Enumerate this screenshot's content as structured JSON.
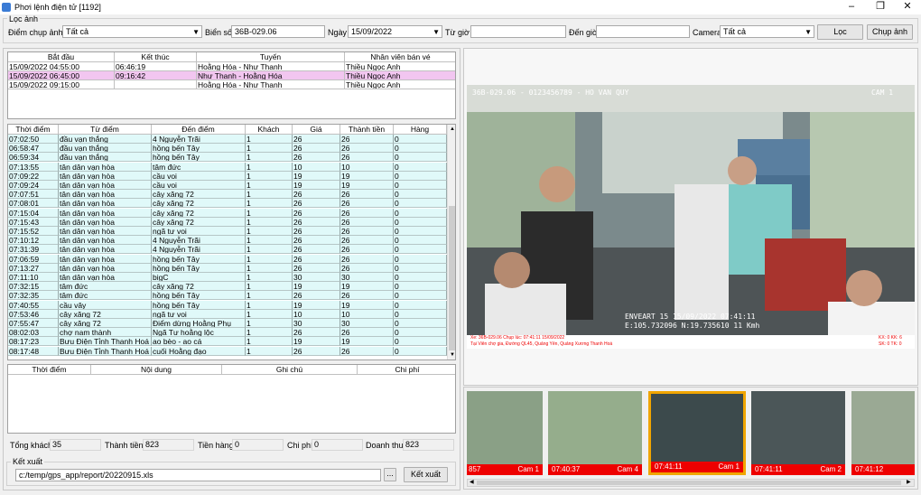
{
  "window": {
    "title": "Phơi lệnh điện tử [1192]"
  },
  "filter": {
    "group_label": "Lọc ảnh",
    "diem_label": "Điểm chụp ảnh",
    "diem_value": "Tất cả",
    "bienso_label": "Biển số",
    "bienso_value": "36B-029.06",
    "ngay_label": "Ngày",
    "ngay_value": "15/09/2022",
    "tugio_label": "Từ giờ",
    "tugio_value": "",
    "dengio_label": "Đến giờ",
    "dengio_value": "",
    "camera_label": "Camera",
    "camera_value": "Tất cả",
    "loc_btn": "Lọc",
    "chup_btn": "Chụp ảnh"
  },
  "trips": {
    "headers": [
      "Bắt đầu",
      "Kết thúc",
      "Tuyến",
      "Nhân viên bán vé"
    ],
    "rows": [
      [
        "15/09/2022 04:55:00",
        "06:46:19",
        "Hoằng Hóa - Như Thanh",
        "Thiều Ngọc Anh"
      ],
      [
        "15/09/2022 06:45:00",
        "09:16:42",
        "Như Thanh - Hoằng Hóa",
        "Thiều Ngọc Anh"
      ],
      [
        "15/09/2022 09:15:00",
        "",
        "Hoằng Hóa - Như Thanh",
        "Thiều Ngọc Anh"
      ]
    ],
    "selected_color": "#f2c6f0"
  },
  "tickets": {
    "headers": [
      "Thời điểm",
      "Từ điểm",
      "Đến điểm",
      "Khách",
      "Giá",
      "Thành tiền",
      "Hàng"
    ],
    "rows": [
      [
        "07:02:50",
        "đầu vạn thắng",
        "4 Nguyễn Trãi",
        "1",
        "26",
        "26",
        "0"
      ],
      [
        "06:58:47",
        "đầu vạn thắng",
        "hồng bến Tây",
        "1",
        "26",
        "26",
        "0"
      ],
      [
        "06:59:34",
        "đầu vạn thắng",
        "hồng bến Tây",
        "1",
        "26",
        "26",
        "0"
      ],
      [
        "07:13:55",
        "tân dân vạn hòa",
        "tâm đức",
        "1",
        "10",
        "10",
        "0"
      ],
      [
        "07:09:22",
        "tân dân vạn hòa",
        "cầu voi",
        "1",
        "19",
        "19",
        "0"
      ],
      [
        "07:09:24",
        "tân dân vạn hòa",
        "cầu voi",
        "1",
        "19",
        "19",
        "0"
      ],
      [
        "07:07:51",
        "tân dân vạn hòa",
        "cây xăng 72",
        "1",
        "26",
        "26",
        "0"
      ],
      [
        "07:08:01",
        "tân dân vạn hòa",
        "cây xăng 72",
        "1",
        "26",
        "26",
        "0"
      ],
      [
        "07:15:04",
        "tân dân vạn hòa",
        "cây xăng 72",
        "1",
        "26",
        "26",
        "0"
      ],
      [
        "07:15:43",
        "tân dân vạn hòa",
        "cây xăng 72",
        "1",
        "26",
        "26",
        "0"
      ],
      [
        "07:15:52",
        "tân dân vạn hòa",
        "ngã tư voi",
        "1",
        "26",
        "26",
        "0"
      ],
      [
        "07:10:12",
        "tân dân vạn hòa",
        "4 Nguyễn Trãi",
        "1",
        "26",
        "26",
        "0"
      ],
      [
        "07:31:39",
        "tân dân vạn hòa",
        "4 Nguyễn Trãi",
        "1",
        "26",
        "26",
        "0"
      ],
      [
        "07:06:59",
        "tân dân vạn hòa",
        "hồng bến Tây",
        "1",
        "26",
        "26",
        "0"
      ],
      [
        "07:13:27",
        "tân dân vạn hòa",
        "hồng bến Tây",
        "1",
        "26",
        "26",
        "0"
      ],
      [
        "07:11:10",
        "tân dân vạn hòa",
        "bigC",
        "1",
        "30",
        "30",
        "0"
      ],
      [
        "07:32:15",
        "tâm đức",
        "cây xăng 72",
        "1",
        "19",
        "19",
        "0"
      ],
      [
        "07:32:35",
        "tâm đức",
        "hồng bến Tây",
        "1",
        "26",
        "26",
        "0"
      ],
      [
        "07:40:55",
        "cầu vây",
        "hồng bến Tây",
        "1",
        "19",
        "19",
        "0"
      ],
      [
        "07:53:46",
        "cây xăng 72",
        "ngã tư voi",
        "1",
        "10",
        "10",
        "0"
      ],
      [
        "07:55:47",
        "cây xăng 72",
        "Điểm dừng Hoằng Phụ",
        "1",
        "30",
        "30",
        "0"
      ],
      [
        "08:02:03",
        "chợ nam thành",
        "Ngã Tư hoằng lộc",
        "1",
        "26",
        "26",
        "0"
      ],
      [
        "08:17:23",
        "Bưu Điện Tỉnh Thanh Hoá",
        "ao bèo - ao cá",
        "1",
        "19",
        "19",
        "0"
      ],
      [
        "08:17:48",
        "Bưu Điện Tỉnh Thanh Hoá",
        "cuối Hoằng đạo",
        "1",
        "26",
        "26",
        "0"
      ]
    ],
    "row_color": "#e0f9f9"
  },
  "expenses": {
    "headers": [
      "Thời điểm",
      "Nội dung",
      "Ghi chú",
      "Chi phí"
    ]
  },
  "summary": {
    "tong_khach_label": "Tổng khách",
    "tong_khach": "35",
    "thanh_tien_label": "Thành tiền",
    "thanh_tien": "823",
    "tien_hang_label": "Tiền hàng",
    "tien_hang": "0",
    "chi_phi_label": "Chi phí",
    "chi_phi": "0",
    "doanh_thu_label": "Doanh thu",
    "doanh_thu": "823"
  },
  "export": {
    "group_label": "Kết xuất",
    "path": "c:/temp/gps_app/report/20220915.xls",
    "browse_btn": "...",
    "export_btn": "Kết xuất"
  },
  "camera": {
    "osd_top": "36B-029.06 - 0123456789 - HO VAN QUY",
    "osd_cam": "CAM 1",
    "osd_bottom": "ENVEART  15  15/09/2022  07:41:11",
    "osd_coords": "E:105.732096  N:19.735610  11 Kmh",
    "caption1": "Xe: 36B-029.06 Chụp lúc: 07:41:11 15/09/2022",
    "caption2": "Tại Viên chợ gia, Đường QL45, Quảng Yên, Quảng Xương Thanh Hoá",
    "caption_right1": "KX: 0   KK: 6",
    "caption_right2": "SK: 0   TK: 0"
  },
  "thumbnails": [
    {
      "time": "",
      "cam": "Cam 1",
      "partial": "857"
    },
    {
      "time": "07:40:37",
      "cam": "Cam 4"
    },
    {
      "time": "07:41:11",
      "cam": "Cam 1"
    },
    {
      "time": "07:41:11",
      "cam": "Cam 2"
    },
    {
      "time": "07:41:12",
      "cam": ""
    }
  ],
  "accent_selected": "#f0a500"
}
